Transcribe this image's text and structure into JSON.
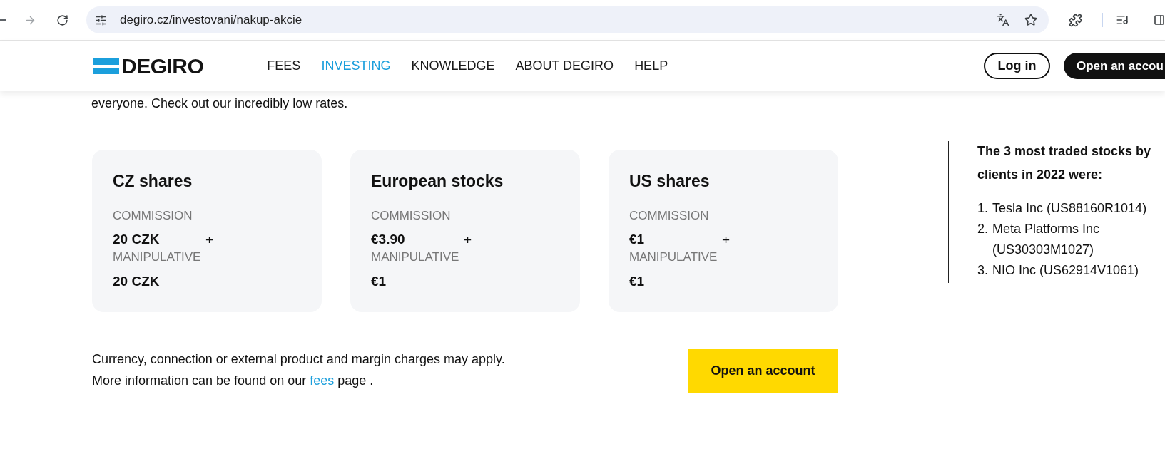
{
  "browser": {
    "url": "degiro.cz/investovani/nakup-akcie"
  },
  "header": {
    "logo": "DEGIRO",
    "nav": [
      {
        "label": "FEES",
        "selected": false
      },
      {
        "label": "INVESTING",
        "selected": true
      },
      {
        "label": "KNOWLEDGE",
        "selected": false
      },
      {
        "label": "ABOUT DEGIRO",
        "selected": false
      },
      {
        "label": "HELP",
        "selected": false
      }
    ],
    "login": "Log in",
    "open_account": "Open an accou"
  },
  "intro": "everyone. Check out our incredibly low rates.",
  "cards": [
    {
      "title": "CZ shares",
      "commission_label": "COMMISSION",
      "commission": "20 CZK",
      "plus": "+",
      "manipulative_label": "MANIPULATIVE",
      "manipulative": "20 CZK"
    },
    {
      "title": "European stocks",
      "commission_label": "COMMISSION",
      "commission": "€3.90",
      "plus": "+",
      "manipulative_label": "MANIPULATIVE",
      "manipulative": "€1"
    },
    {
      "title": "US shares",
      "commission_label": "COMMISSION",
      "commission": "€1",
      "plus": "+",
      "manipulative_label": "MANIPULATIVE",
      "manipulative": "€1"
    }
  ],
  "sidebar": {
    "heading": "The 3 most traded stocks by clients in 2022 were:",
    "items": [
      {
        "number": "1.",
        "text": "Tesla Inc (US88160R1014)"
      },
      {
        "number": "2.",
        "text": "Meta Platforms Inc (US30303M1027)"
      },
      {
        "number": "3.",
        "text": "NIO Inc (US62914V1061)"
      }
    ]
  },
  "footer": {
    "note": "Currency, connection or external product and margin charges may apply.",
    "more_info": {
      "before": "More information can be found on our",
      "link": "fees",
      "after": "page ."
    },
    "button": "Open an account"
  }
}
